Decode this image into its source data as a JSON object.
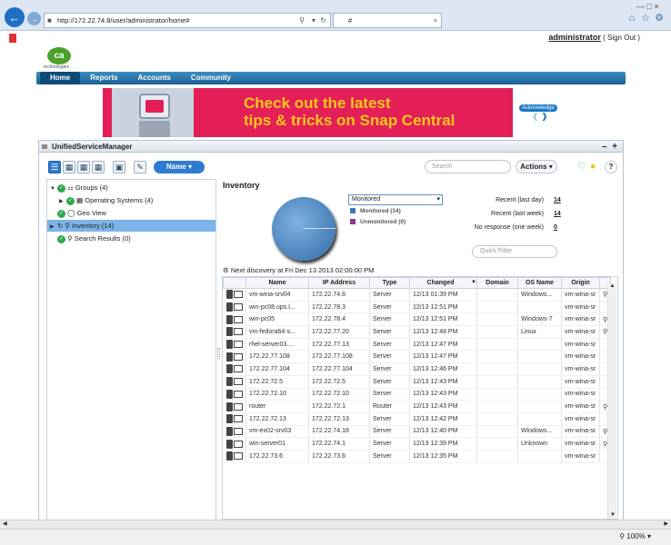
{
  "browser": {
    "url": "http://172.22.74.8/user/administrator/home#",
    "tab_title": "#"
  },
  "site": {
    "user": "administrator",
    "signout": "( Sign Out )",
    "logo": "ca",
    "logo_sub": "technologies",
    "nav": [
      "Home",
      "Reports",
      "Accounts",
      "Community"
    ],
    "banner_line1": "Check out the latest",
    "banner_line2": "tips & tricks on Snap Central",
    "acknowledge": "Acknowledge"
  },
  "panel": {
    "title": "UnifiedServiceManager",
    "sort_button": "Name",
    "search_placeholder": "Search",
    "actions_label": "Actions",
    "help": "?"
  },
  "tree": [
    {
      "label": "Groups (4)"
    },
    {
      "label": "Operating Systems (4)"
    },
    {
      "label": "Geo View"
    },
    {
      "label": "Inventory (14)"
    },
    {
      "label": "Search Results (0)"
    }
  ],
  "inventory": {
    "title": "Inventory",
    "select_value": "Monitored",
    "legend": [
      "Monitored (14)",
      "Unmonitored (0)"
    ],
    "stats": [
      {
        "label": "Recent (last day)",
        "value": "14"
      },
      {
        "label": "Recent (last week)",
        "value": "14"
      },
      {
        "label": "No response (one week)",
        "value": "0"
      }
    ],
    "quick_filter": "Quick Filter",
    "next_discovery": "Next discovery at Fri Dec 13 2013 02:00:00 PM",
    "pie_data": {
      "monitored": 14,
      "unmonitored": 0
    },
    "colors": {
      "monitored": "#3d7ab8",
      "unmonitored": "#8a3a8c"
    }
  },
  "table": {
    "headers": [
      "Name",
      "IP Address",
      "Type",
      "Changed",
      "Domain",
      "OS Name",
      "Origin"
    ],
    "rows": [
      [
        "vm-wina-srv04",
        "172.22.74.8",
        "Server",
        "12/13 01:39 PM",
        "",
        "Windows...",
        "vm-wina-sr"
      ],
      [
        "win-pc08.ops.l...",
        "172.22.78.3",
        "Server",
        "12/13 12:51 PM",
        "",
        "",
        "vm-wina-sr"
      ],
      [
        "win-pc05",
        "172.22.78.4",
        "Server",
        "12/13 12:51 PM",
        "",
        "Windows-7",
        "vm-wina-sr"
      ],
      [
        "vm-fedora64-s...",
        "172.22.77.20",
        "Server",
        "12/13 12:48 PM",
        "",
        "Linux",
        "vm-wina-sr"
      ],
      [
        "rhel-server03....",
        "172.22.77.13",
        "Server",
        "12/13 12:47 PM",
        "",
        "",
        "vm-wina-sr"
      ],
      [
        "172.22.77.108",
        "172.22.77.108",
        "Server",
        "12/13 12:47 PM",
        "",
        "",
        "vm-wina-sr"
      ],
      [
        "172.22.77.104",
        "172.22.77.104",
        "Server",
        "12/13 12:46 PM",
        "",
        "",
        "vm-wina-sr"
      ],
      [
        "172.22.72.5",
        "172.22.72.5",
        "Server",
        "12/13 12:43 PM",
        "",
        "",
        "vm-wina-sr"
      ],
      [
        "172.22.72.10",
        "172.22.72.10",
        "Server",
        "12/13 12:43 PM",
        "",
        "",
        "vm-wina-sr"
      ],
      [
        "router",
        "172.22.72.1",
        "Router",
        "12/13 12:43 PM",
        "",
        "",
        "vm-wina-sr"
      ],
      [
        "172.22.72.13",
        "172.22.72.13",
        "Server",
        "12/13 12:42 PM",
        "",
        "",
        "vm-wina-sr"
      ],
      [
        "vm-ex02-srv03",
        "172.22.74.18",
        "Server",
        "12/13 12:40 PM",
        "",
        "Windows...",
        "vm-wina-sr"
      ],
      [
        "win-server01",
        "172.22.74.1",
        "Server",
        "12/13 12:39 PM",
        "",
        "Unknown",
        "vm-wina-sr"
      ],
      [
        "172.22.73.6",
        "172.22.73.6",
        "Server",
        "12/13 12:35 PM",
        "",
        "",
        "vm-wina-sr"
      ]
    ],
    "key_rows": [
      0,
      2,
      3,
      9,
      11,
      12
    ]
  },
  "status": {
    "zoom": "100%"
  }
}
